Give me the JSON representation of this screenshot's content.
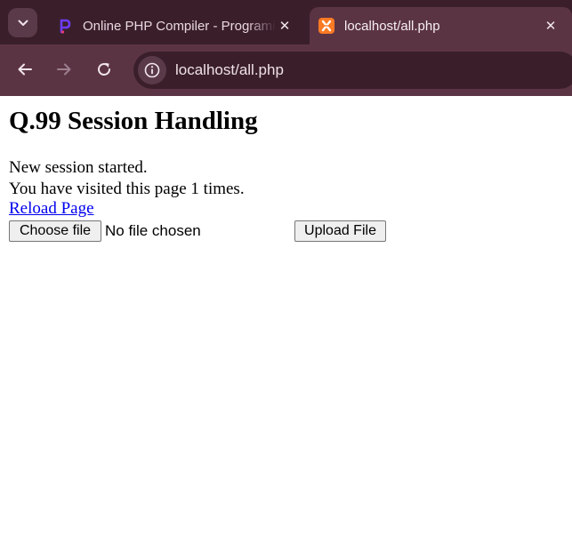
{
  "browser": {
    "tabs": [
      {
        "title": "Online PHP Compiler - Programiz",
        "favicon": "programiz-icon",
        "active": false
      },
      {
        "title": "localhost/all.php",
        "favicon": "xampp-icon",
        "active": true
      }
    ],
    "close_glyph": "✕",
    "url": "localhost/all.php",
    "colors": {
      "tabbar": "#3a1f2b",
      "toolbar": "#5b3444",
      "xampp": "#fb7a24",
      "programiz": "#6c3cf5"
    }
  },
  "page": {
    "heading": "Q.99 Session Handling",
    "status_line": "New session started.",
    "visits_line": "You have visited this page 1 times.",
    "reload_link": "Reload Page",
    "file_input": {
      "button_label": "Choose file",
      "status": "No file chosen"
    },
    "upload_button": "Upload File"
  }
}
